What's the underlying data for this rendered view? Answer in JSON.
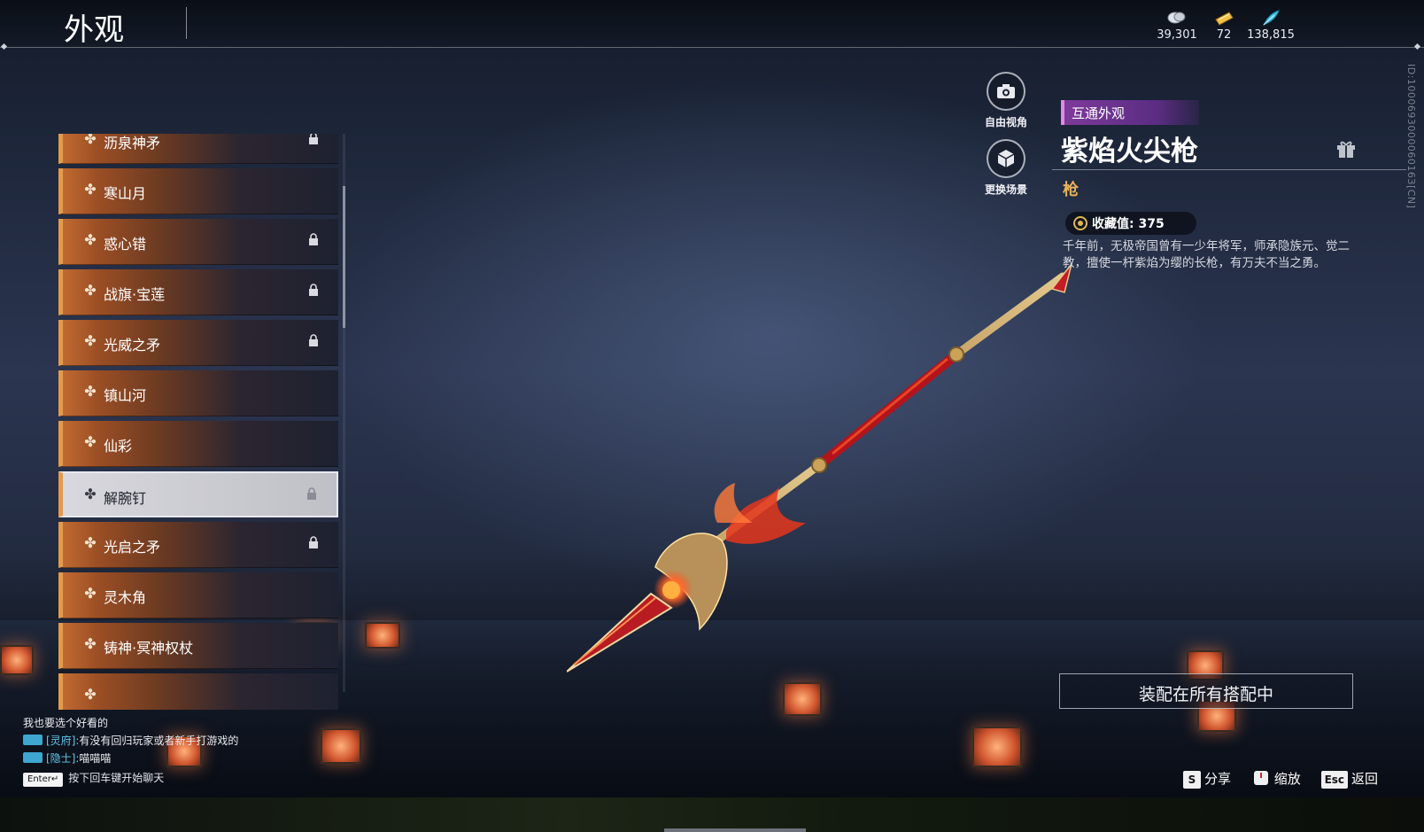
{
  "header": {
    "title": "外观",
    "currencies": [
      {
        "icon": "silver-coin-icon",
        "value": "39,301"
      },
      {
        "icon": "gold-ticket-icon",
        "value": "72"
      },
      {
        "icon": "feather-token-icon",
        "value": "138,815"
      }
    ]
  },
  "side_id": "ID:100069300006016З[CN]",
  "list": {
    "items": [
      {
        "label": "沥泉神矛",
        "locked": true
      },
      {
        "label": "寒山月",
        "locked": false
      },
      {
        "label": "惑心错",
        "locked": true
      },
      {
        "label": "战旗·宝莲",
        "locked": true
      },
      {
        "label": "光威之矛",
        "locked": true
      },
      {
        "label": "镇山河",
        "locked": false
      },
      {
        "label": "仙彩",
        "locked": false
      },
      {
        "label": "解腕钉",
        "locked": true,
        "selected": true
      },
      {
        "label": "光启之矛",
        "locked": true
      },
      {
        "label": "灵木角",
        "locked": false
      },
      {
        "label": "铸神·冥神权杖",
        "locked": false
      }
    ]
  },
  "camera": {
    "free_view": "自由视角",
    "change_scene": "更换场景"
  },
  "item": {
    "tag": "互通外观",
    "name": "紫焰火尖枪",
    "type": "枪",
    "collect_label": "收藏值: 375",
    "description": "千年前，无极帝国曾有一少年将军，师承隐族元、觉二教，擅使一杆紫焰为缨的长枪，有万夫不当之勇。"
  },
  "equip_button": "装配在所有搭配中",
  "chat": {
    "lines": [
      {
        "channel": "",
        "text": "我也要选个好看的"
      },
      {
        "channel": "[灵府]:",
        "text": "有没有回归玩家或者新手打游戏的"
      },
      {
        "channel": "[隐士]:",
        "text": "喵喵喵"
      }
    ],
    "hint_key": "Enter↵",
    "hint_text": "按下回车键开始聊天"
  },
  "hotkeys": [
    {
      "key": "S",
      "label": "分享"
    },
    {
      "key": "",
      "label": "缩放"
    },
    {
      "key": "Esc",
      "label": "返回"
    }
  ],
  "colors": {
    "accent_orange": "#e59a4a",
    "tag_purple": "#7d3a9a",
    "type_gold": "#e9b25a",
    "chat_channel": "#62c8ee"
  }
}
